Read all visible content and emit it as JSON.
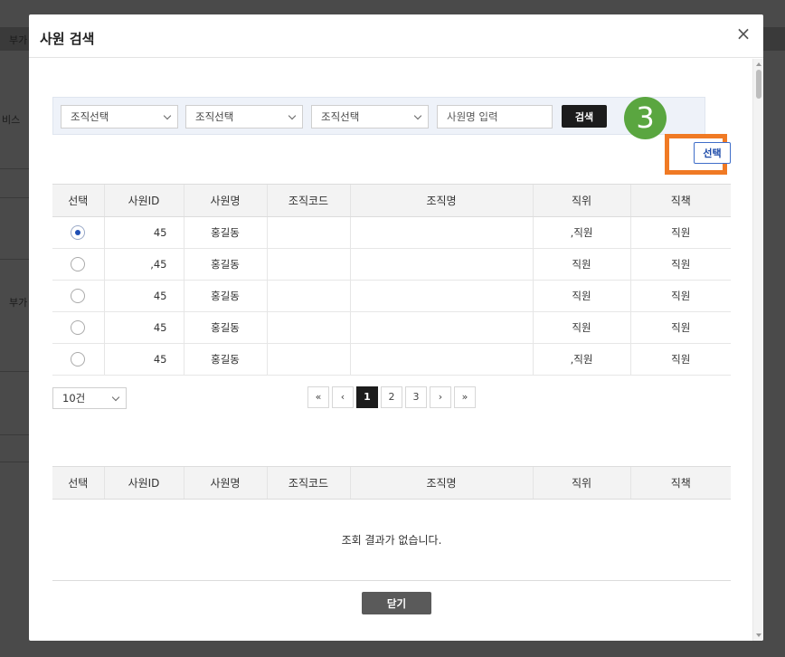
{
  "background": {
    "fragments": [
      "부가",
      "비스",
      "부가"
    ]
  },
  "modal": {
    "title": "사원 검색",
    "close_symbol": "×"
  },
  "search": {
    "selects": [
      "조직선택",
      "조직선택",
      "조직선택"
    ],
    "input_placeholder": "사원명 입력",
    "button_label": "검색"
  },
  "step_marker": "3",
  "select_button_label": "선택",
  "table_columns": [
    "선택",
    "사원ID",
    "사원명",
    "조직코드",
    "조직명",
    "직위",
    "직책"
  ],
  "rows": [
    {
      "selected": true,
      "id": "45",
      "name": "홍길동",
      "org_code": "",
      "org_name": "",
      "position": ",직원",
      "duty": "직원"
    },
    {
      "selected": false,
      "id": ",45",
      "name": "홍길동",
      "org_code": "",
      "org_name": "",
      "position": "직원",
      "duty": "직원"
    },
    {
      "selected": false,
      "id": "45",
      "name": "홍길동",
      "org_code": "",
      "org_name": "",
      "position": "직원",
      "duty": "직원"
    },
    {
      "selected": false,
      "id": "45",
      "name": "홍길동",
      "org_code": "",
      "org_name": "",
      "position": "직원",
      "duty": "직원"
    },
    {
      "selected": false,
      "id": "45",
      "name": "홍길동",
      "org_code": "",
      "org_name": "",
      "position": ",직원",
      "duty": "직원"
    }
  ],
  "page_size": "10건",
  "pagination": {
    "first": "«",
    "prev": "‹",
    "pages": [
      "1",
      "2",
      "3"
    ],
    "current_page": "1",
    "next": "›",
    "last": "»"
  },
  "result_table_columns": [
    "선택",
    "사원ID",
    "사원명",
    "조직코드",
    "조직명",
    "직위",
    "직책"
  ],
  "empty_message": "조회 결과가 없습니다.",
  "footer_close_label": "닫기",
  "colors": {
    "accent": "#1f4fb5",
    "step_marker": "#5aa640",
    "highlight": "#f07a24",
    "dark_button": "#1c1c1c"
  }
}
